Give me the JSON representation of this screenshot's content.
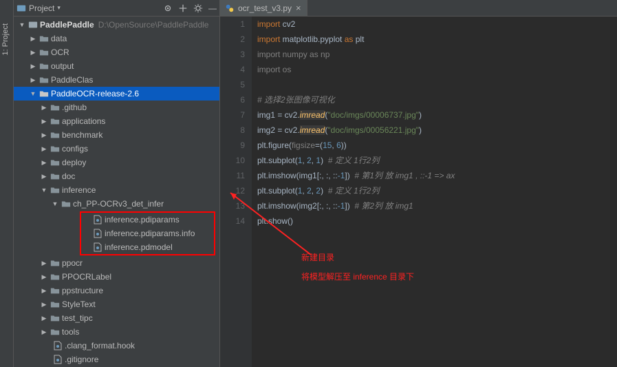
{
  "vertical_tab": "1: Project",
  "panel": {
    "title": "Project"
  },
  "root": {
    "name": "PaddlePaddle",
    "path": "D:\\OpenSource\\PaddlePaddle"
  },
  "tree": {
    "level1": [
      {
        "label": "data",
        "exp": "collapsed"
      },
      {
        "label": "OCR",
        "exp": "collapsed"
      },
      {
        "label": "output",
        "exp": "collapsed"
      },
      {
        "label": "PaddleClas",
        "exp": "collapsed"
      }
    ],
    "selected": "PaddleOCR-release-2.6",
    "level2": [
      {
        "label": ".github",
        "exp": "collapsed"
      },
      {
        "label": "applications",
        "exp": "collapsed"
      },
      {
        "label": "benchmark",
        "exp": "collapsed"
      },
      {
        "label": "configs",
        "exp": "collapsed"
      },
      {
        "label": "deploy",
        "exp": "collapsed"
      },
      {
        "label": "doc",
        "exp": "collapsed"
      }
    ],
    "inference": "inference",
    "inf_sub": "ch_PP-OCRv3_det_infer",
    "inf_files": [
      "inference.pdiparams",
      "inference.pdiparams.info",
      "inference.pdmodel"
    ],
    "level2b": [
      {
        "label": "ppocr",
        "exp": "collapsed"
      },
      {
        "label": "PPOCRLabel",
        "exp": "collapsed"
      },
      {
        "label": "ppstructure",
        "exp": "collapsed"
      },
      {
        "label": "StyleText",
        "exp": "collapsed"
      },
      {
        "label": "test_tipc",
        "exp": "collapsed"
      },
      {
        "label": "tools",
        "exp": "collapsed"
      }
    ],
    "files2": [
      ".clang_format.hook",
      ".gitignore"
    ]
  },
  "tab": {
    "title": "ocr_test_v3.py"
  },
  "code": {
    "line_count": 14,
    "l1a": "import",
    "l1b": " cv2",
    "l2a": "import",
    "l2b": " matplotlib.pyplot ",
    "l2c": "as",
    "l2d": " plt",
    "l3a": "import",
    "l3b": " numpy ",
    "l3c": "as",
    "l3d": " np",
    "l4a": "import",
    "l4b": " os",
    "l6": "# 选择2张图像可视化",
    "l7a": "img1 = cv2.",
    "l7b": "imread",
    "l7c": "(",
    "l7d": "\"doc/imgs/00006737.jpg\"",
    "l7e": ")",
    "l8a": "img2 = cv2.",
    "l8b": "imread",
    "l8c": "(",
    "l8d": "\"doc/imgs/00056221.jpg\"",
    "l8e": ")",
    "l9a": "plt.figure(",
    "l9b": "figsize",
    "l9c": "=(",
    "l9d": "15",
    "l9e": ", ",
    "l9f": "6",
    "l9g": "))",
    "l10a": "plt.subplot(",
    "l10b": "1",
    "l10c": ", ",
    "l10d": "2",
    "l10e": ", ",
    "l10f": "1",
    "l10g": ")  ",
    "l10h": "# 定义 1行2列",
    "l11a": "plt.imshow(img1[:, :, ::",
    "l11b": "-1",
    "l11c": "])  ",
    "l11d": "# 第1列 放 img1 , ::-1 => ax",
    "l12a": "plt.subplot(",
    "l12b": "1",
    "l12c": ", ",
    "l12d": "2",
    "l12e": ", ",
    "l12f": "2",
    "l12g": ")  ",
    "l12h": "# 定义 1行2列",
    "l13a": "plt.imshow(img2[:, :, ::",
    "l13b": "-1",
    "l13c": "])  ",
    "l13d": "# 第2列 放 img1",
    "l14a": "plt.show()"
  },
  "annotation": {
    "line1": "新建目录",
    "line2": "将模型解压至 inference 目录下"
  }
}
